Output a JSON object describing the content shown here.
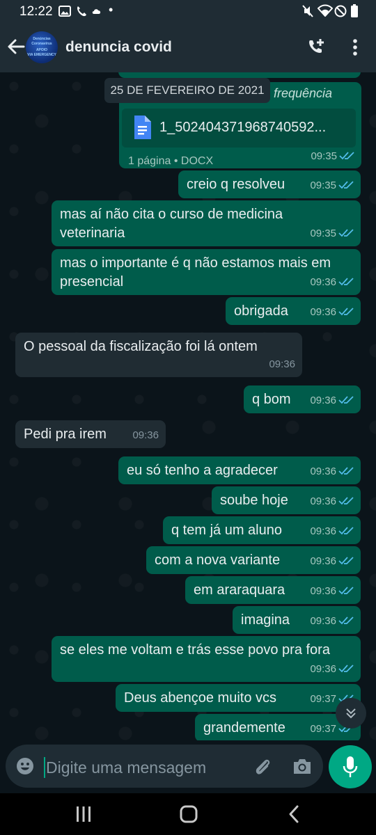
{
  "status_bar": {
    "time": "12:22",
    "dot": "•"
  },
  "header": {
    "title": "denuncia covid",
    "avatar_lines": [
      "Denúncias",
      "Coronavírus",
      "APOIO",
      "VIA EMERGENCY"
    ]
  },
  "chat": {
    "date_chip": "25 DE FEVEREIRO DE 2021",
    "doc_message": {
      "partial_text": "frequência",
      "file_name": "1_502404371968740592...",
      "info": "1 página • DOCX",
      "time": "09:35"
    },
    "messages": [
      {
        "text": "creio q resolveu",
        "time": "09:35",
        "dir": "out"
      },
      {
        "text": "mas aí não cita o curso de medicina veterinaria",
        "time": "09:35",
        "dir": "out"
      },
      {
        "text": "mas o importante é q não estamos mais em presencial",
        "time": "09:36",
        "dir": "out"
      },
      {
        "text": "obrigada",
        "time": "09:36",
        "dir": "out"
      },
      {
        "text": "O pessoal da fiscalização foi lá ontem",
        "time": "09:36",
        "dir": "in"
      },
      {
        "text": "q bom",
        "time": "09:36",
        "dir": "out"
      },
      {
        "text": "Pedi pra irem",
        "time": "09:36",
        "dir": "in"
      },
      {
        "text": "eu só tenho a agradecer",
        "time": "09:36",
        "dir": "out"
      },
      {
        "text": "soube hoje",
        "time": "09:36",
        "dir": "out"
      },
      {
        "text": "q tem já um aluno",
        "time": "09:36",
        "dir": "out"
      },
      {
        "text": "com a nova variante",
        "time": "09:36",
        "dir": "out"
      },
      {
        "text": "em araraquara",
        "time": "09:36",
        "dir": "out"
      },
      {
        "text": "imagina",
        "time": "09:36",
        "dir": "out"
      },
      {
        "text": "se eles me voltam e trás esse povo pra fora",
        "time": "09:36",
        "dir": "out"
      },
      {
        "text": "Deus abençoe muito vcs",
        "time": "09:37",
        "dir": "out"
      },
      {
        "text": "grandemente",
        "time": "09:37",
        "dir": "out"
      }
    ]
  },
  "input": {
    "placeholder": "Digite uma mensagem"
  },
  "colors": {
    "outgoing": "#005c4b",
    "incoming": "#202c33",
    "accent": "#00a884",
    "read_ticks": "#53bdeb"
  },
  "icons": [
    "back-arrow-icon",
    "add-call-icon",
    "more-vert-icon",
    "document-icon",
    "double-check-icon",
    "chevrons-down-icon",
    "emoji-icon",
    "paperclip-icon",
    "camera-icon",
    "microphone-icon"
  ]
}
